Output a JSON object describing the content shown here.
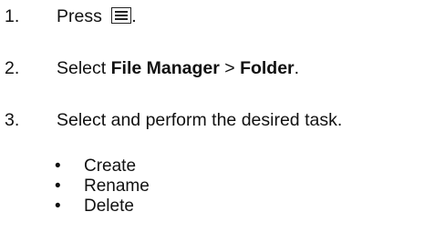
{
  "steps": [
    {
      "number": "1.",
      "text_before": "Press ",
      "icon": "menu-list-icon",
      "text_after": "."
    },
    {
      "number": "2.",
      "text_before": "Select ",
      "bold_1": "File Manager",
      "separator": " > ",
      "bold_2": "Folder",
      "text_after": "."
    },
    {
      "number": "3.",
      "text": "Select and perform the desired task."
    }
  ],
  "tasks": [
    {
      "bullet": "•",
      "label": "Create"
    },
    {
      "bullet": "•",
      "label": "Rename"
    },
    {
      "bullet": "•",
      "label": "Delete"
    }
  ]
}
